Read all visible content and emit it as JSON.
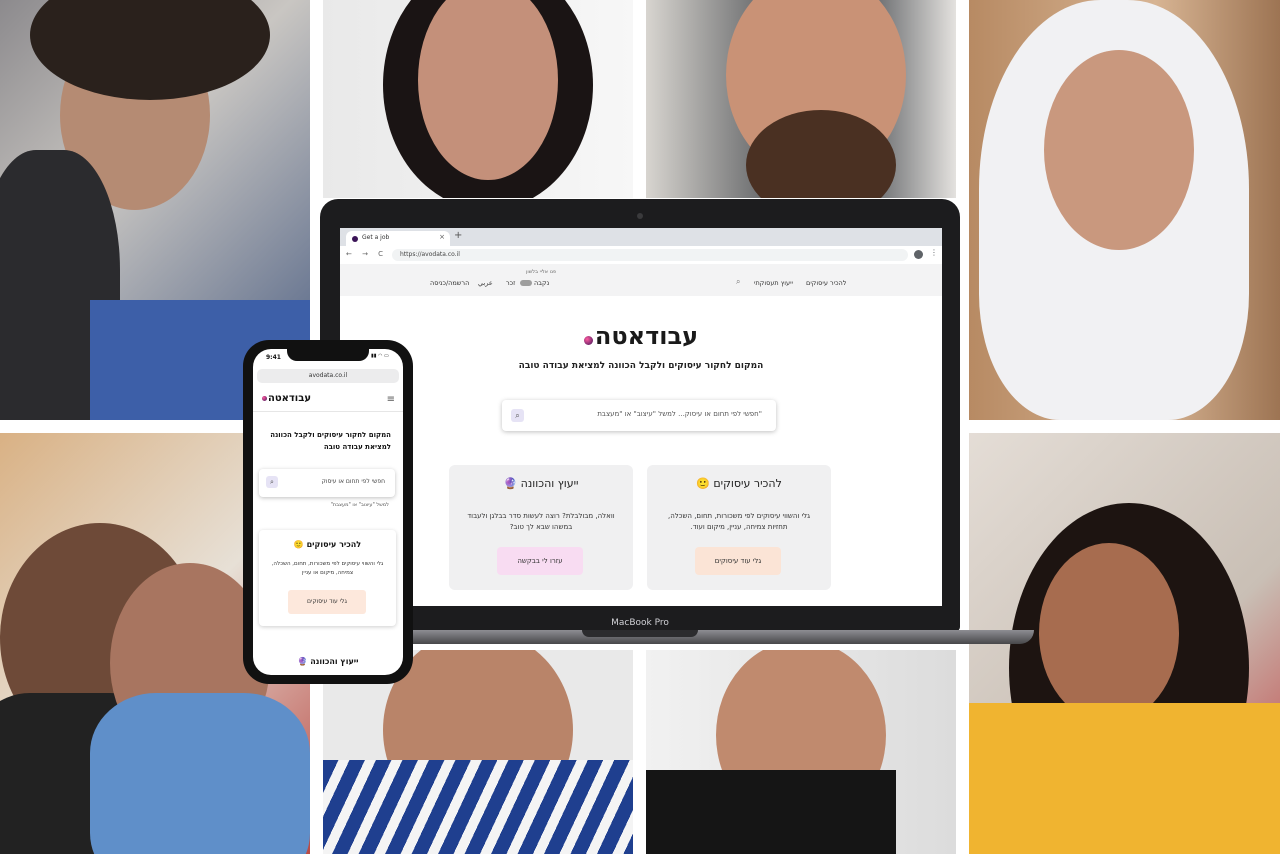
{
  "laptop": {
    "model_label": "MacBook Pro",
    "browser": {
      "tab_title": "Get a job",
      "tab_close": "×",
      "new_tab": "+",
      "nav_buttons": "← → C",
      "url": "https://avodata.co.il",
      "menu_icon": "⋮"
    },
    "site": {
      "nav": {
        "about_employment": "להכיר עיסוקים",
        "career_consulting": "ייעוץ תעסוקתי",
        "search_icon": "⌕",
        "gender_caption": "פנו אליי בלשון",
        "female": "נקבה",
        "male": "זכר",
        "arabic": "عربي",
        "login": "הרשמה/כניסה"
      },
      "logo": "עבודאטה",
      "tagline": "המקום לחקור עיסוקים ולקבל הכוונה למציאת עבודה טובה",
      "search_placeholder": "חפשי לפי תחום או עיסוק... למשל \"עיצוב\" או \"מעצבת\"",
      "search_icon": "⌕",
      "cards": [
        {
          "title": "להכיר עיסוקים 🙂",
          "description": "גלי והשווי עיסוקים לפי משכורות, תחום, השכלה, תחזיות צמיחה, עניין, מיקום ועוד.",
          "button": "גלי עוד עיסוקים",
          "button_color": "#fbe4d6"
        },
        {
          "title": "ייעוץ והכוונה 🔮",
          "description": "וואלה, מבולבלת? רוצה לעשות סדר בבלגן ולעבוד במשהו שבא לך טוב?",
          "button": "עזרו לי בבקשה",
          "button_color": "#f8dcf2"
        }
      ]
    }
  },
  "phone": {
    "time": "9:41",
    "status_icons": "▮▮ ◠ ▭",
    "url": "avodata.co.il",
    "logo": "עבודאטה",
    "menu_icon": "≡",
    "tagline": "המקום לחקור עיסוקים ולקבל הכוונה למציאת עבודה טובה",
    "search_placeholder": "חפשי לפי תחום או עיסוק",
    "search_icon": "⌕",
    "search_example": "למשל \"עיצוב\" או \"מעצבת\"",
    "card": {
      "title": "להכיר עיסוקים 🙂",
      "description": "גלי והשווי עיסוקים לפי משכורות, תחום, השכלה, צמיחה, מיקום או עניין",
      "button": "גלי עוד עיסוקים"
    },
    "next_card_title": "ייעוץ והכוונה 🔮"
  },
  "colors": {
    "brand_dark": "#3b1457",
    "brand_pink": "#ff5aa0",
    "card_bg": "#f0f0f1"
  }
}
